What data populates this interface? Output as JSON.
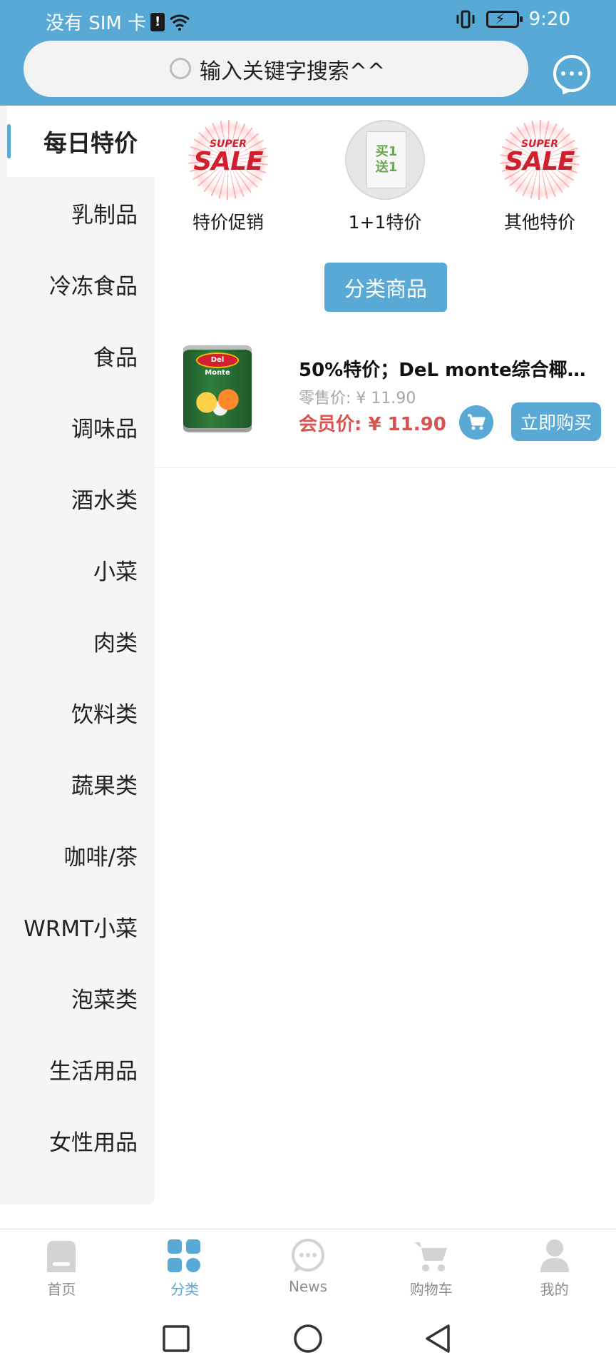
{
  "status_bar": {
    "carrier": "没有 SIM 卡",
    "sim_alert_glyph": "!",
    "time": "9:20"
  },
  "search": {
    "placeholder": "输入关键字搜索^^"
  },
  "sidebar": {
    "items": [
      {
        "label": "每日特价",
        "active": true
      },
      {
        "label": "乳制品"
      },
      {
        "label": "冷冻食品"
      },
      {
        "label": "食品"
      },
      {
        "label": "调味品"
      },
      {
        "label": "酒水类"
      },
      {
        "label": "小菜"
      },
      {
        "label": "肉类"
      },
      {
        "label": "饮料类"
      },
      {
        "label": "蔬果类"
      },
      {
        "label": "咖啡/茶"
      },
      {
        "label": "WRMT小菜"
      },
      {
        "label": "泡菜类"
      },
      {
        "label": "生活用品"
      },
      {
        "label": "女性用品"
      }
    ]
  },
  "promos": [
    {
      "label": "特价促销",
      "badge_top": "SUPER",
      "badge_main": "SALE"
    },
    {
      "label": "1+1特价",
      "badge_text": "买1\n送1"
    },
    {
      "label": "其他特价",
      "badge_top": "SUPER",
      "badge_main": "SALE"
    }
  ],
  "category_button": "分类商品",
  "products": [
    {
      "title": "50%特价；DeL monte综合椰果…",
      "retail_price": "零售价: ¥ 11.90",
      "member_price": "会员价: ¥ 11.90",
      "buy_label": "立即购买",
      "image_brand": "Del Monte"
    }
  ],
  "bottom_nav": [
    {
      "label": "首页",
      "icon": "home-icon"
    },
    {
      "label": "分类",
      "icon": "category-icon",
      "active": true
    },
    {
      "label": "News",
      "icon": "chat-icon"
    },
    {
      "label": "购物车",
      "icon": "cart-icon"
    },
    {
      "label": "我的",
      "icon": "user-icon"
    }
  ],
  "colors": {
    "accent": "#58a9d6",
    "price_red": "#d9534f",
    "sidebar_bg": "#f5f5f5"
  }
}
